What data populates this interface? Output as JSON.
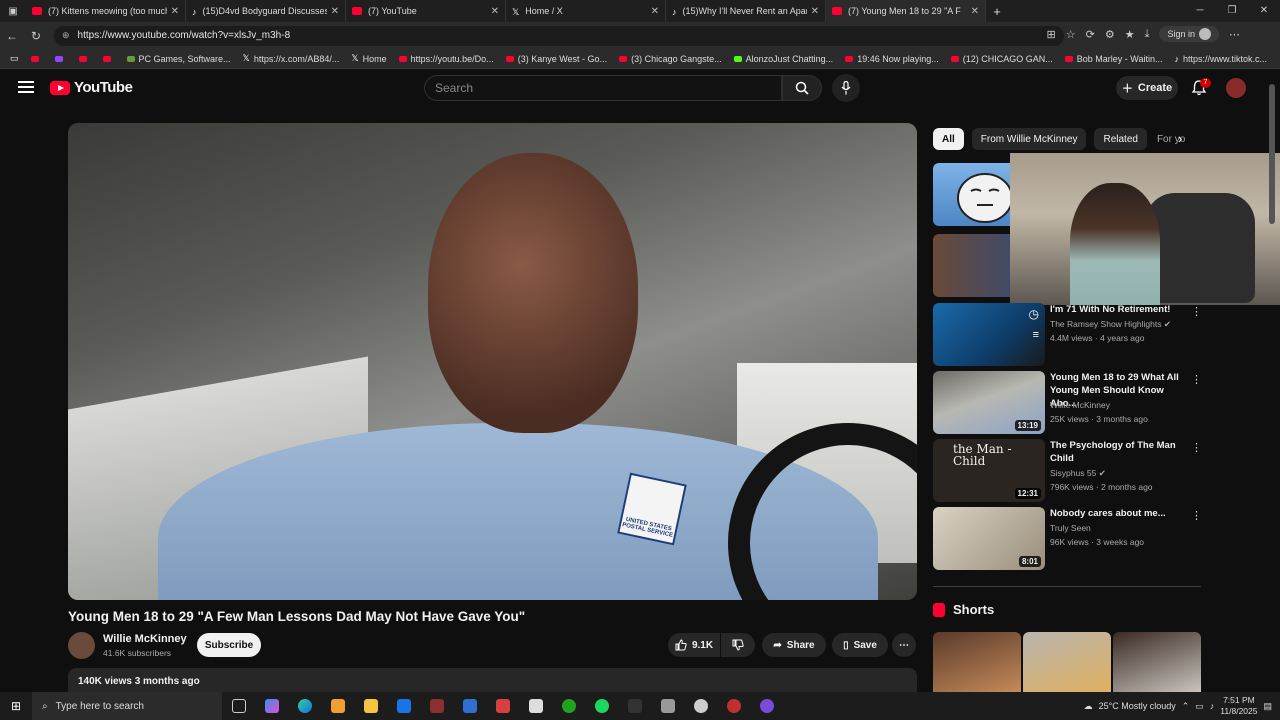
{
  "browser": {
    "tabs": [
      {
        "label": "(7) Kittens meowing (too much c",
        "icon": "youtube-favicon"
      },
      {
        "label": "(15)D4vd Bodyguard Discusses C",
        "icon": "tiktok-favicon"
      },
      {
        "label": "(7) YouTube",
        "icon": "youtube-favicon"
      },
      {
        "label": "Home / X",
        "icon": "x-favicon"
      },
      {
        "label": "(15)Why I'll Never Rent an Apartm",
        "icon": "tiktok-favicon"
      },
      {
        "label": "(7) Young Men 18 to 29 \"A F",
        "icon": "youtube-favicon",
        "active": true
      }
    ],
    "url": "https://www.youtube.com/watch?v=xlsJv_m3h-8",
    "sign_in": "Sign in",
    "bookmarks": [
      {
        "label": "",
        "icon": "youtube-favicon"
      },
      {
        "label": "",
        "icon": "twitch-favicon"
      },
      {
        "label": "",
        "icon": "youtube-favicon"
      },
      {
        "label": "",
        "icon": "youtube-favicon"
      },
      {
        "label": "PC Games, Software...",
        "icon": "globe-favicon"
      },
      {
        "label": "https://x.com/AB84/...",
        "icon": "x-favicon"
      },
      {
        "label": "Home",
        "icon": "x-favicon"
      },
      {
        "label": "https://youtu.be/Do...",
        "icon": "youtube-favicon"
      },
      {
        "label": "(3) Kanye West - Go...",
        "icon": "youtube-favicon"
      },
      {
        "label": "(3) Chicago Gangste...",
        "icon": "youtube-favicon"
      },
      {
        "label": "AlonzoJust Chatting...",
        "icon": "kick-favicon"
      },
      {
        "label": "19:46 Now playing...",
        "icon": "youtube-favicon"
      },
      {
        "label": "(12) CHICAGO GAN...",
        "icon": "youtube-favicon"
      },
      {
        "label": "Bob Marley - Waitin...",
        "icon": "youtube-favicon"
      },
      {
        "label": "https://www.tiktok.c...",
        "icon": "tiktok-favicon"
      }
    ]
  },
  "youtube": {
    "logo": "YouTube",
    "search_placeholder": "Search",
    "create_label": "Create",
    "notification_count": "7"
  },
  "video": {
    "title": "Young Men 18 to 29 \"A Few Man Lessons Dad May Not Have Gave You\"",
    "patch_text": "UNITED STATES POSTAL SERVICE",
    "channel": "Willie McKinney",
    "subscribers": "41.6K subscribers",
    "subscribe_label": "Subscribe",
    "likes": "9.1K",
    "share_label": "Share",
    "save_label": "Save",
    "views_date": "140K views  3 months ago"
  },
  "chips": [
    "All",
    "From Willie McKinney",
    "Related",
    "For yo"
  ],
  "recommendations": [
    {
      "title": "I'm 71 With No Retirement!",
      "channel": "The Ramsey Show Highlights",
      "verified": true,
      "meta": "4.4M views · 4 years ago",
      "duration": ""
    },
    {
      "title": "Young Men 18 to 29 What All Young Men Should Know Abo...",
      "channel": "Willie McKinney",
      "verified": false,
      "meta": "25K views · 3 months ago",
      "duration": "13:19"
    },
    {
      "title": "The Psychology of The Man Child",
      "channel": "Sisyphus 55",
      "verified": true,
      "meta": "796K views · 2 months ago",
      "duration": "12:31",
      "thumb_text": "the Man - Child"
    },
    {
      "title": "Nobody cares about me...",
      "channel": "Truly Seen",
      "verified": false,
      "meta": "96K views · 3 weeks ago",
      "duration": "8:01"
    }
  ],
  "shorts_label": "Shorts",
  "taskbar": {
    "search_placeholder": "Type here to search",
    "weather": "25°C  Mostly cloudy",
    "time": "7:51 PM",
    "date": "11/8/2025"
  }
}
